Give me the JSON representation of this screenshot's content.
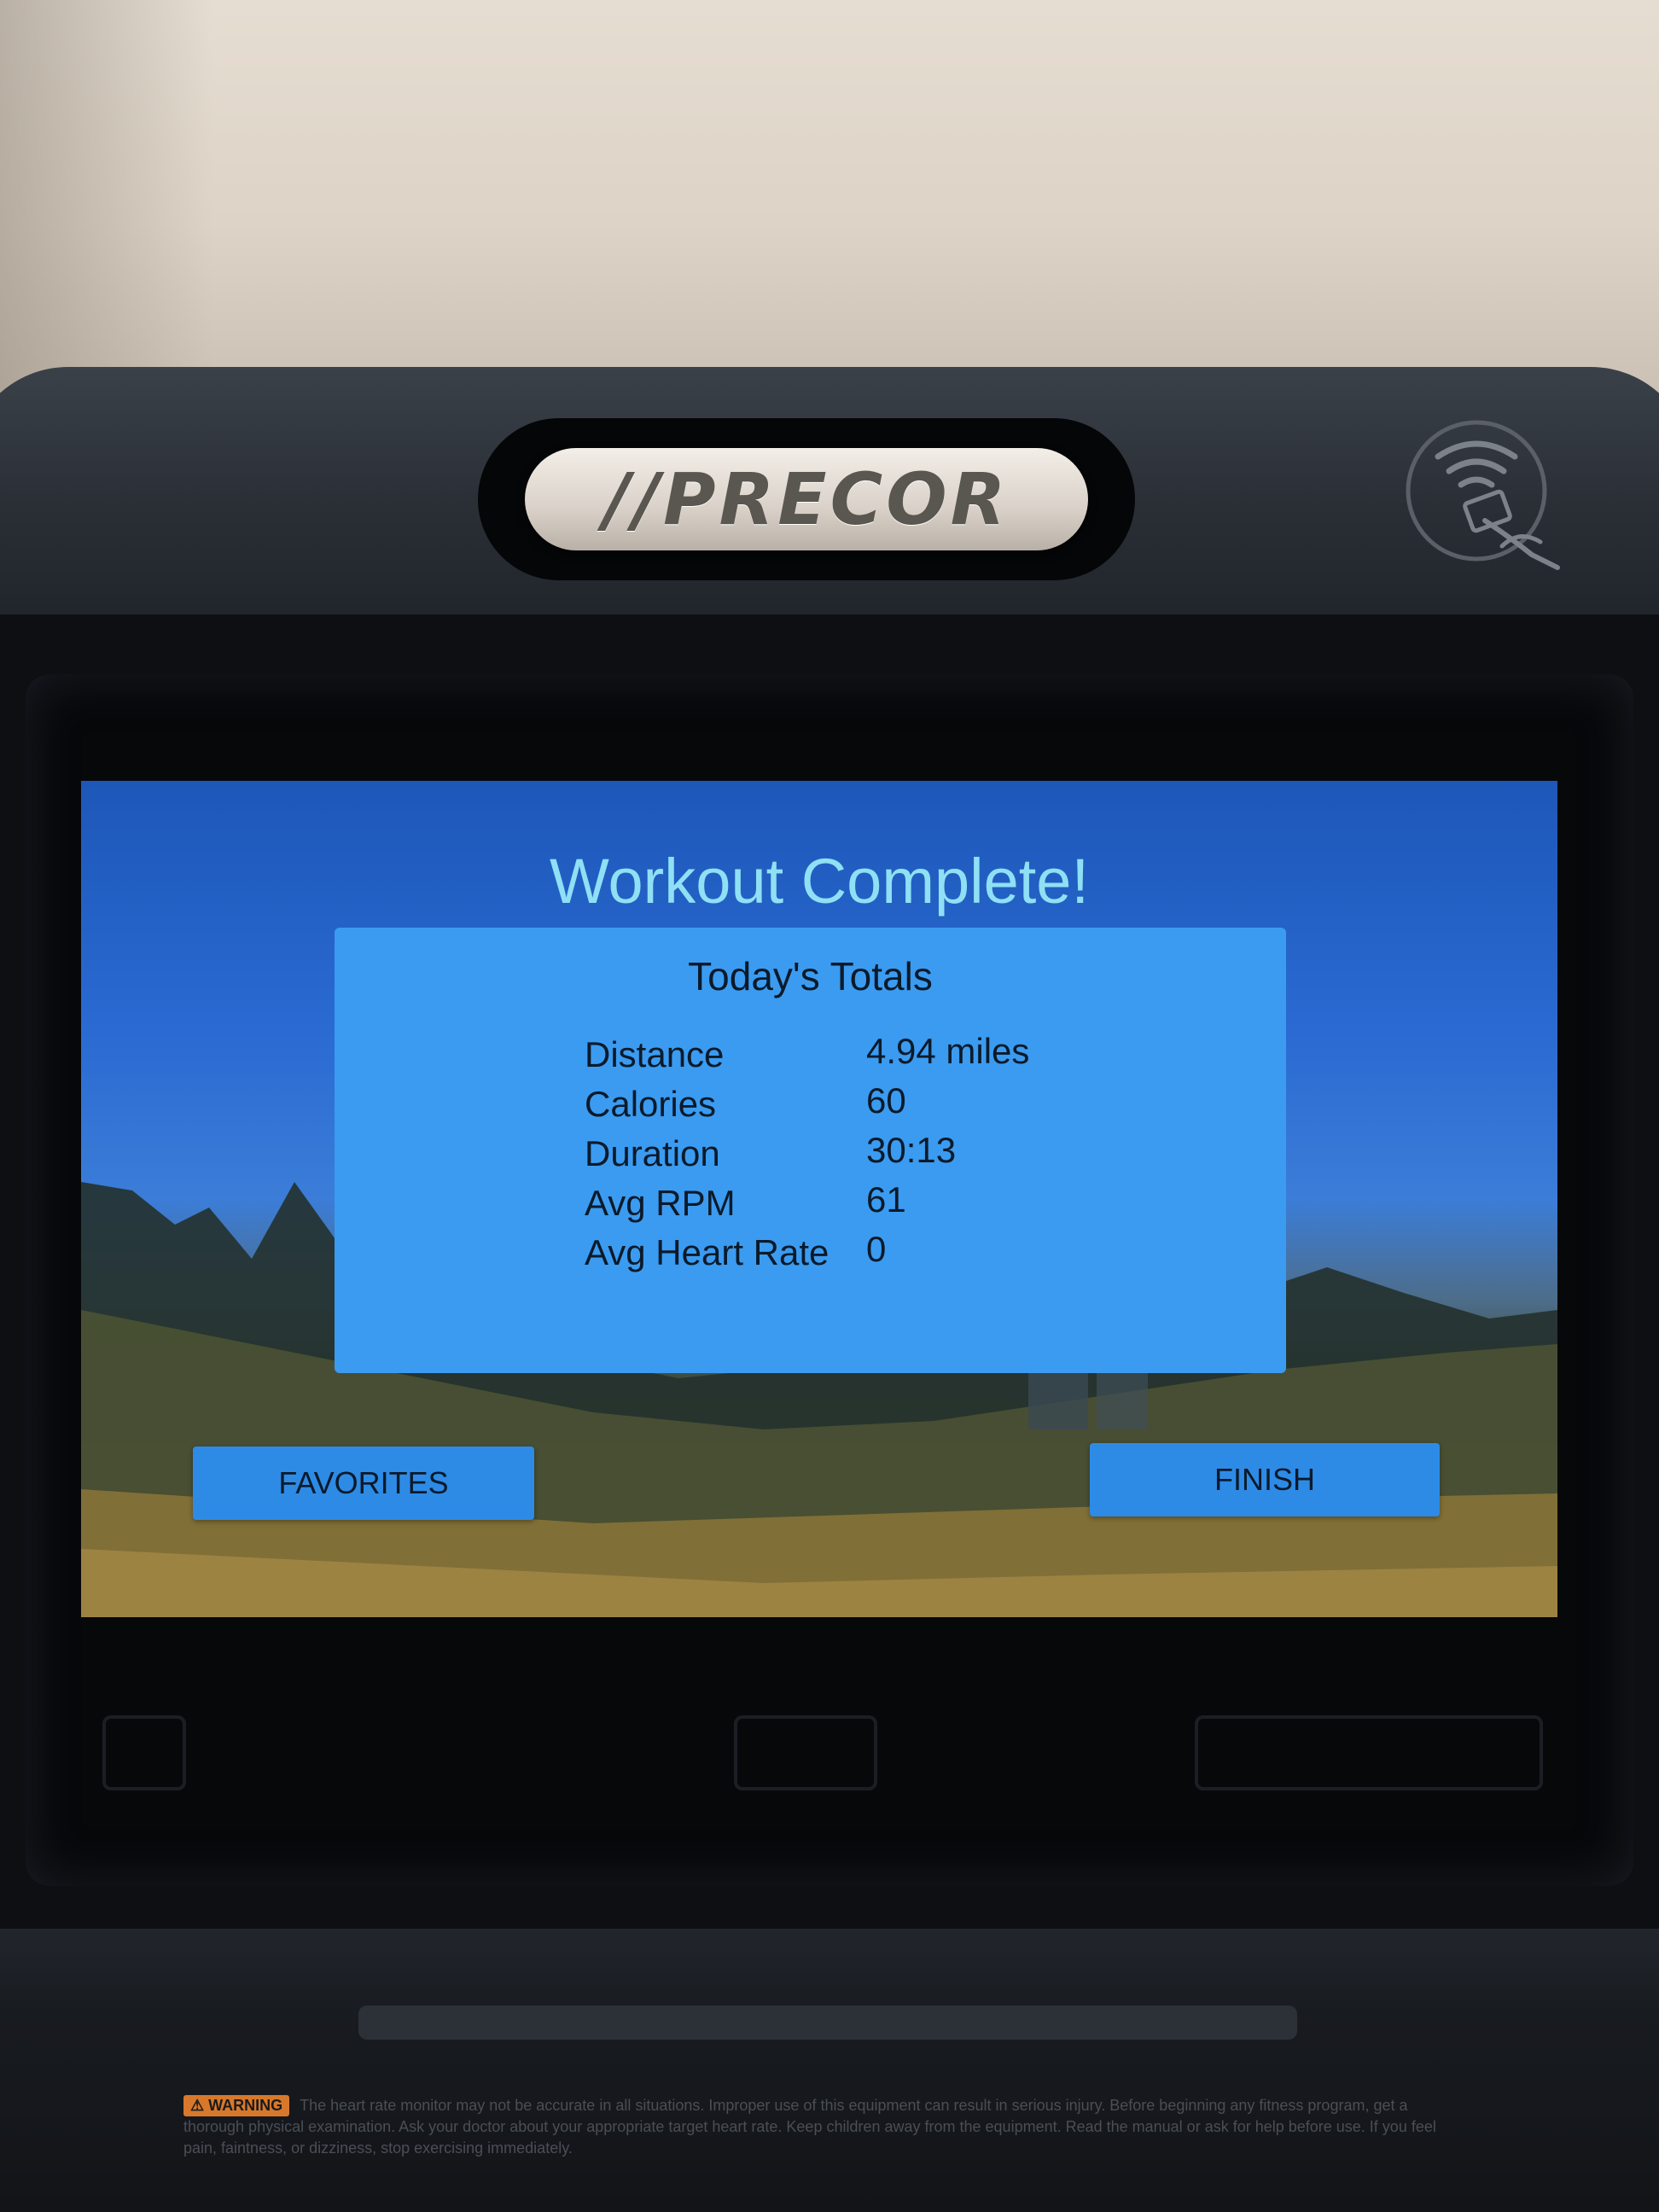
{
  "brand": {
    "logo_text": "//PRECOR"
  },
  "screen": {
    "title": "Workout Complete!",
    "totals": {
      "heading": "Today's Totals",
      "rows": [
        {
          "label": "Distance",
          "value": "4.94 miles"
        },
        {
          "label": "Calories",
          "value": "60"
        },
        {
          "label": "Duration",
          "value": "30:13"
        },
        {
          "label": "Avg RPM",
          "value": "61"
        },
        {
          "label": "Avg Heart Rate",
          "value": "0"
        }
      ]
    },
    "buttons": {
      "favorites_label": "FAVORITES",
      "finish_label": "FINISH"
    }
  },
  "warning": {
    "badge": "⚠ WARNING",
    "text": "The heart rate monitor may not be accurate in all situations. Improper use of this equipment can result in serious injury. Before beginning any fitness program, get a thorough physical examination. Ask your doctor about your appropriate target heart rate. Keep children away from the equipment. Read the manual or ask for help before use. If you feel pain, faintness, or dizziness, stop exercising immediately."
  },
  "icons": {
    "nfc": "contactless-tap-icon",
    "logo": "precor-logo"
  },
  "colors": {
    "title": "#8fe0f4",
    "panel": "#3b9bf0",
    "button": "#2d8be6",
    "warning_badge": "#d7782c"
  }
}
